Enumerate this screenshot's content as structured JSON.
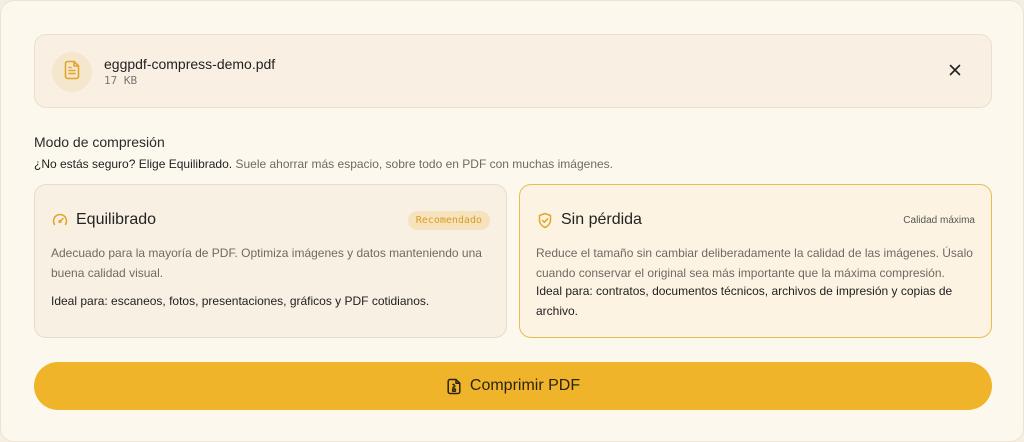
{
  "file": {
    "name": "eggpdf-compress-demo.pdf",
    "size": "17 KB",
    "icon": "file-text-icon",
    "close_icon": "close-icon"
  },
  "compression": {
    "title": "Modo de compresión",
    "hint_strong": "¿No estás seguro? Elige Equilibrado.",
    "hint_rest": "Suele ahorrar más espacio, sobre todo en PDF con muchas imágenes.",
    "modes": [
      {
        "id": "balanced",
        "icon": "gauge-icon",
        "title": "Equilibrado",
        "badge": "Recomendado",
        "description": "Adecuado para la mayoría de PDF. Optimiza imágenes y datos manteniendo una buena calidad visual.",
        "ideal": "Ideal para: escaneos, fotos, presentaciones, gráficos y PDF cotidianos."
      },
      {
        "id": "lossless",
        "icon": "shield-check-icon",
        "title": "Sin pérdida",
        "badge": "Calidad máxima",
        "description": "Reduce el tamaño sin cambiar deliberadamente la calidad de las imágenes. Úsalo cuando conservar el original sea más importante que la máxima compresión.",
        "ideal": "Ideal para: contratos, documentos técnicos, archivos de impresión y copias de archivo.",
        "selected": true
      }
    ]
  },
  "action": {
    "label": "Comprimir PDF",
    "icon": "file-compress-icon"
  },
  "colors": {
    "accent": "#f0b42a",
    "accent_text": "#d79c24",
    "selected_border": "#e7bd52",
    "background": "#fdf8ee"
  }
}
